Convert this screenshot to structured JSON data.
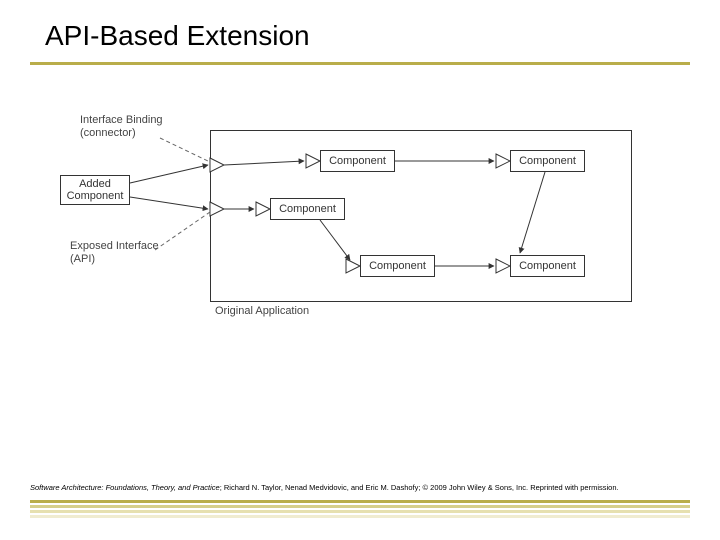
{
  "title": "API-Based Extension",
  "labels": {
    "interface_binding_l1": "Interface Binding",
    "interface_binding_l2": "(connector)",
    "exposed_api_l1": "Exposed Interface",
    "exposed_api_l2": "(API)",
    "original_app": "Original Application"
  },
  "boxes": {
    "added": "Added Component",
    "comp1": "Component",
    "comp2": "Component",
    "comp3": "Component",
    "comp4": "Component",
    "comp5": "Component"
  },
  "citation": {
    "book": "Software Architecture: Foundations, Theory, and Practice",
    "rest": "; Richard N. Taylor, Nenad Medvidovic, and Eric M. Dashofy; © 2009 John Wiley & Sons, Inc. Reprinted with permission."
  }
}
